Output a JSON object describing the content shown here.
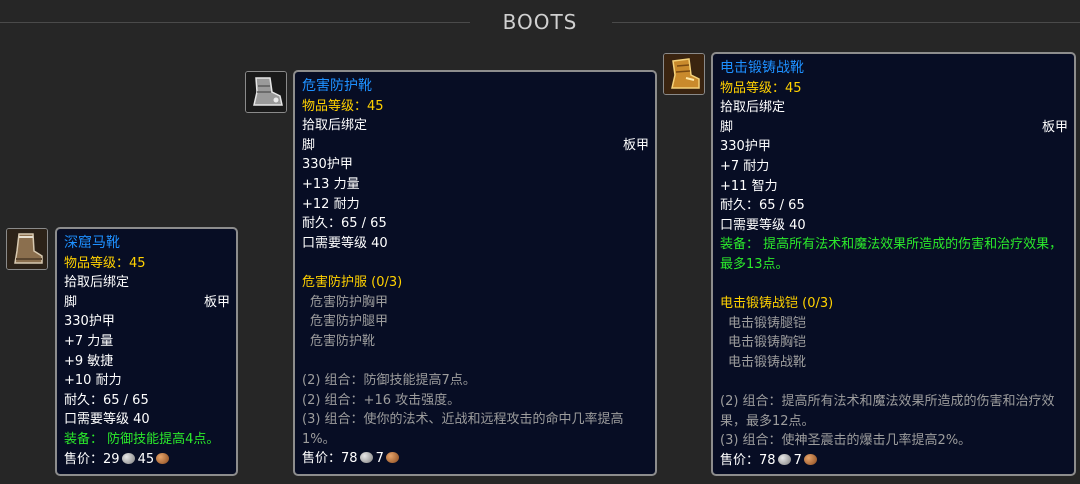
{
  "section": {
    "title": "BOOTS"
  },
  "items": [
    {
      "icon": "leather-boot-icon",
      "name": "深窟马靴",
      "item_level": "物品等级：45",
      "bind": "拾取后绑定",
      "slot": "脚",
      "armor_type": "板甲",
      "armor": "330护甲",
      "stats": [
        "+7 力量",
        "+9 敏捷",
        "+10 耐力"
      ],
      "durability": "耐久：65 / 65",
      "required_level": "口需要等级 40",
      "equip": "装备： 防御技能提高4点。",
      "sell_label": "售价：",
      "sell_silver": "29",
      "sell_copper": "45"
    },
    {
      "icon": "steel-boot-icon",
      "name": "危害防护靴",
      "item_level": "物品等级：45",
      "bind": "拾取后绑定",
      "slot": "脚",
      "armor_type": "板甲",
      "armor": "330护甲",
      "stats": [
        "+13 力量",
        "+12 耐力"
      ],
      "durability": "耐久：65 / 65",
      "required_level": "口需要等级 40",
      "set_name": "危害防护服 (0/3)",
      "set_pieces": [
        "危害防护胸甲",
        "危害防护腿甲",
        "危害防护靴"
      ],
      "set_bonuses": [
        "(2) 组合：防御技能提高7点。",
        "(2) 组合：+16 攻击强度。",
        "(3) 组合：使你的法术、近战和远程攻击的命中几率提高1%。"
      ],
      "sell_label": "售价：",
      "sell_silver": "78",
      "sell_copper": "7"
    },
    {
      "icon": "golden-boot-icon",
      "name": "电击锻铸战靴",
      "item_level": "物品等级：45",
      "bind": "拾取后绑定",
      "slot": "脚",
      "armor_type": "板甲",
      "armor": "330护甲",
      "stats": [
        "+7 耐力",
        "+11 智力"
      ],
      "durability": "耐久：65 / 65",
      "required_level": "口需要等级 40",
      "equip": "装备： 提高所有法术和魔法效果所造成的伤害和治疗效果，最多13点。",
      "set_name": "电击锻铸战铠 (0/3)",
      "set_pieces": [
        "电击锻铸腿铠",
        "电击锻铸胸铠",
        "电击锻铸战靴"
      ],
      "set_bonuses": [
        "(2) 组合：提高所有法术和魔法效果所造成的伤害和治疗效果，最多12点。",
        "(3) 组合：使神圣震击的爆击几率提高2%。"
      ],
      "sell_label": "售价：",
      "sell_silver": "78",
      "sell_copper": "7"
    }
  ]
}
